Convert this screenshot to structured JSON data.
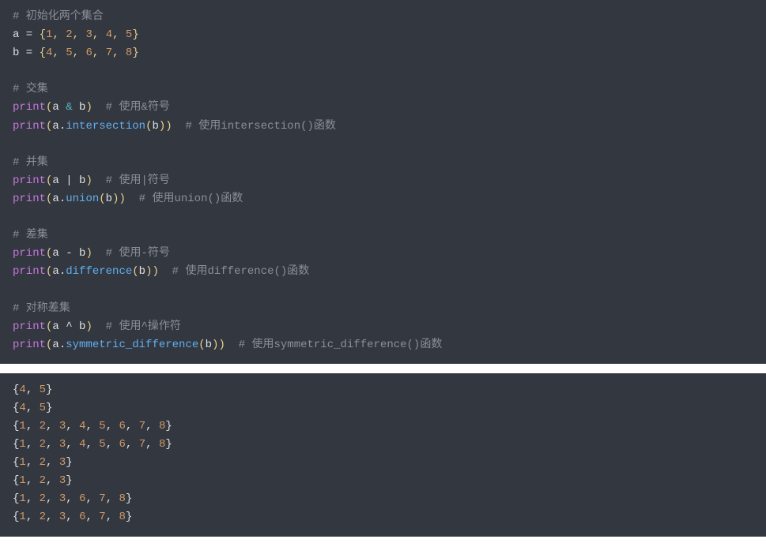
{
  "code": {
    "c_init": "# 初始化两个集合",
    "a_name": "a",
    "b_name": "b",
    "eq": " = ",
    "lb": "{",
    "rb": "}",
    "sep": ", ",
    "a_vals": [
      "1",
      "2",
      "3",
      "4",
      "5"
    ],
    "b_vals": [
      "4",
      "5",
      "6",
      "7",
      "8"
    ],
    "c_inter_h": "# 交集",
    "print": "print",
    "lp": "(",
    "rp": ")",
    "amp": " & ",
    "c_inter1": "  # 使用&符号",
    "dot": ".",
    "intersection": "intersection",
    "c_inter2": "  # 使用intersection()函数",
    "c_union_h": "# 并集",
    "pipe": " | ",
    "c_union1": "  # 使用|符号",
    "union": "union",
    "c_union2": "  # 使用union()函数",
    "c_diff_h": "# 差集",
    "minus": " - ",
    "c_diff1": "  # 使用-符号",
    "difference": "difference",
    "c_diff2": "  # 使用difference()函数",
    "c_sym_h": "# 对称差集",
    "caret": " ^ ",
    "c_sym1": "  # 使用^操作符",
    "symdiff": "symmetric_difference",
    "c_sym2": "  # 使用symmetric_difference()函数"
  },
  "output": {
    "lb": "{",
    "rb": "}",
    "sep": ", ",
    "lines": [
      [
        "4",
        "5"
      ],
      [
        "4",
        "5"
      ],
      [
        "1",
        "2",
        "3",
        "4",
        "5",
        "6",
        "7",
        "8"
      ],
      [
        "1",
        "2",
        "3",
        "4",
        "5",
        "6",
        "7",
        "8"
      ],
      [
        "1",
        "2",
        "3"
      ],
      [
        "1",
        "2",
        "3"
      ],
      [
        "1",
        "2",
        "3",
        "6",
        "7",
        "8"
      ],
      [
        "1",
        "2",
        "3",
        "6",
        "7",
        "8"
      ]
    ]
  }
}
